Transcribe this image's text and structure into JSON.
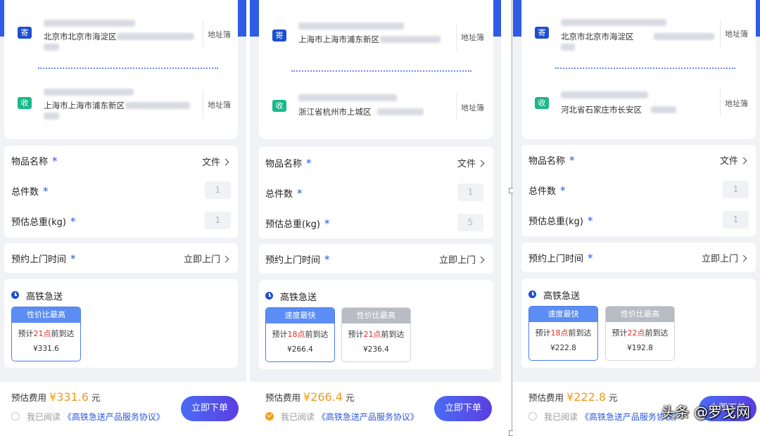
{
  "panels": [
    {
      "sender": {
        "tag": "寄",
        "address": "北京市北京市海淀区",
        "book": "地址簿"
      },
      "receiver": {
        "tag": "收",
        "address": "上海市上海市浦东新区",
        "book": "地址簿"
      },
      "item": {
        "label": "物品名称",
        "star": "*",
        "value": "文件"
      },
      "count": {
        "label": "总件数",
        "star": "*",
        "value": "1"
      },
      "weight": {
        "label": "预估总重(kg)",
        "star": "*",
        "value": "1"
      },
      "pickup": {
        "label": "预约上门时间",
        "star": "*",
        "value": "立即上门"
      },
      "service": {
        "title": "高铁急送",
        "options": [
          {
            "head": "性价比最高",
            "eta_pre": "预计",
            "eta_hour": "21点",
            "eta_post": "前到达",
            "price": "¥331.6",
            "selected": true
          }
        ]
      },
      "fee": {
        "label": "预估费用",
        "currency": "¥",
        "value": "331.6",
        "unit": "元"
      },
      "agreement": {
        "prefix": "我已阅读",
        "link": "《高铁急送产品服务协议》",
        "checked": false
      },
      "order_button": "立即下单"
    },
    {
      "sender": {
        "tag": "寄",
        "address": "上海市上海市浦东新区",
        "book": "地址簿"
      },
      "receiver": {
        "tag": "收",
        "address": "浙江省杭州市上城区",
        "book": "地址簿"
      },
      "item": {
        "label": "物品名称",
        "star": "*",
        "value": "文件"
      },
      "count": {
        "label": "总件数",
        "star": "*",
        "value": "1"
      },
      "weight": {
        "label": "预估总重(kg)",
        "star": "*",
        "value": "5"
      },
      "pickup": {
        "label": "预约上门时间",
        "star": "*",
        "value": "立即上门"
      },
      "service": {
        "title": "高铁急送",
        "options": [
          {
            "head": "速度最快",
            "eta_pre": "预计",
            "eta_hour": "18点",
            "eta_post": "前到达",
            "price": "¥266.4",
            "selected": true
          },
          {
            "head": "性价比最高",
            "eta_pre": "预计",
            "eta_hour": "21点",
            "eta_post": "前到达",
            "price": "¥236.4",
            "selected": false
          }
        ]
      },
      "fee": {
        "label": "预估费用",
        "currency": "¥",
        "value": "266.4",
        "unit": "元"
      },
      "agreement": {
        "prefix": "我已阅读",
        "link": "《高铁急送产品服务协议》",
        "checked": true
      },
      "order_button": "立即下单"
    },
    {
      "sender": {
        "tag": "寄",
        "address": "北京市北京市海淀区",
        "book": "地址簿"
      },
      "receiver": {
        "tag": "收",
        "address": "河北省石家庄市长安区",
        "book": "地址簿"
      },
      "item": {
        "label": "物品名称",
        "star": "*",
        "value": "文件"
      },
      "count": {
        "label": "总件数",
        "star": "*",
        "value": "1"
      },
      "weight": {
        "label": "预估总重(kg)",
        "star": "*",
        "value": "1"
      },
      "pickup": {
        "label": "预约上门时间",
        "star": "*",
        "value": "立即上门"
      },
      "service": {
        "title": "高铁急送",
        "options": [
          {
            "head": "速度最快",
            "eta_pre": "预计",
            "eta_hour": "18点",
            "eta_post": "前到达",
            "price": "¥222.8",
            "selected": true
          },
          {
            "head": "性价比最高",
            "eta_pre": "预计",
            "eta_hour": "22点",
            "eta_post": "前到达",
            "price": "¥192.8",
            "selected": false
          }
        ]
      },
      "fee": {
        "label": "预估费用",
        "currency": "¥",
        "value": "222.8",
        "unit": "元"
      },
      "agreement": {
        "prefix": "我已阅读",
        "link": "《高铁急送产品服务协议》",
        "checked": false
      },
      "order_button": "立即下单"
    }
  ],
  "watermark": "头条 @罗戈网",
  "colors": {
    "brand": "#2f5be6",
    "accent_orange": "#f39a1c",
    "eta_red": "#e02b2b",
    "receiver_tag": "#19b98a"
  }
}
